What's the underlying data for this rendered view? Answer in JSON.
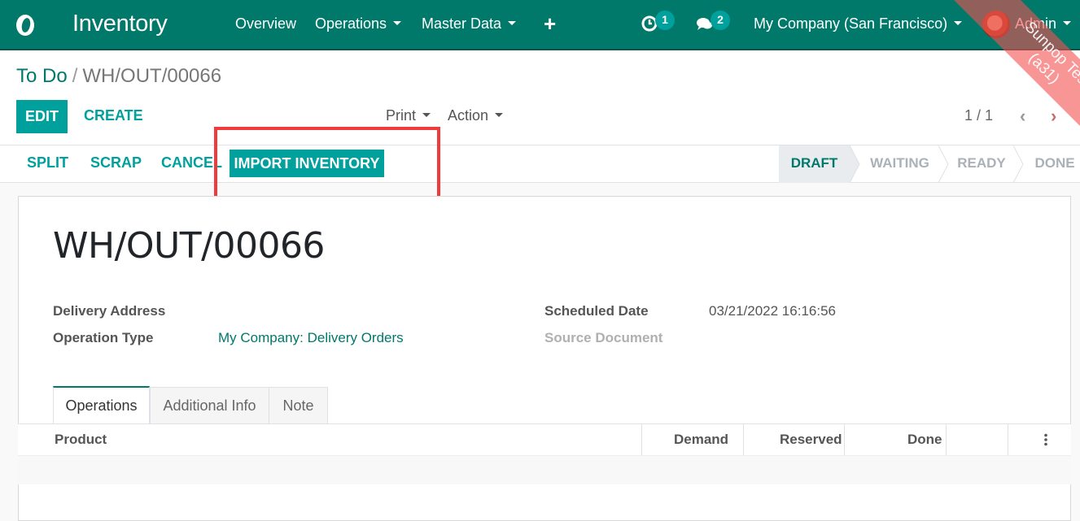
{
  "navbar": {
    "logo_icon": "odoo-logo-icon",
    "app_title": "Inventory",
    "menu": [
      {
        "label": "Overview",
        "has_dropdown": false
      },
      {
        "label": "Operations",
        "has_dropdown": true
      },
      {
        "label": "Master Data",
        "has_dropdown": true
      }
    ],
    "quick_create_icon": "plus-icon",
    "activities": {
      "icon": "clock-icon",
      "count": "1"
    },
    "messages": {
      "icon": "chat-bubbles-icon",
      "count": "2"
    },
    "company": "My Company (San Francisco)",
    "user": "Admin",
    "colors": {
      "bar": "#00796b",
      "badge": "#00a09d"
    }
  },
  "ribbon": {
    "line1": "Sunpop Test",
    "line2": "(a31)",
    "color": "#f35050"
  },
  "breadcrumb": {
    "parent": "To Do",
    "separator": "/",
    "current": "WH/OUT/00066"
  },
  "toolbar": {
    "edit_label": "EDIT",
    "create_label": "CREATE",
    "print_label": "Print",
    "action_label": "Action",
    "pager": "1 / 1",
    "prev_icon": "chevron-left-icon",
    "next_icon": "chevron-right-icon"
  },
  "statusbar": {
    "buttons": [
      "SPLIT",
      "SCRAP",
      "CANCEL",
      "IMPORT INVENTORY"
    ],
    "stages": [
      {
        "label": "DRAFT",
        "active": true
      },
      {
        "label": "WAITING",
        "active": false
      },
      {
        "label": "READY",
        "active": false
      },
      {
        "label": "DONE",
        "active": false
      }
    ],
    "highlight_color": "#ef3b3b"
  },
  "record": {
    "name": "WH/OUT/00066",
    "fields": {
      "delivery_address": {
        "label": "Delivery Address",
        "value": ""
      },
      "operation_type": {
        "label": "Operation Type",
        "value": "My Company: Delivery Orders"
      },
      "scheduled_date": {
        "label": "Scheduled Date",
        "value": "03/21/2022 16:16:56"
      },
      "source_document": {
        "label": "Source Document",
        "value": ""
      }
    }
  },
  "tabs": [
    {
      "label": "Operations",
      "active": true
    },
    {
      "label": "Additional Info",
      "active": false
    },
    {
      "label": "Note",
      "active": false
    }
  ],
  "table": {
    "columns": [
      "Product",
      "Demand",
      "Reserved",
      "Done"
    ],
    "options_icon": "vertical-ellipsis-icon",
    "rows": []
  }
}
